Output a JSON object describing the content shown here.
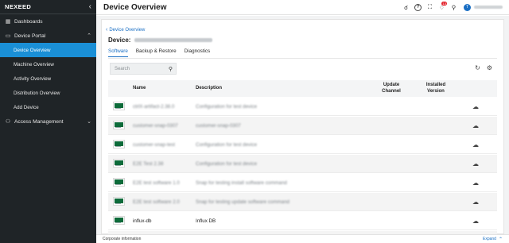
{
  "app": {
    "brand": "NEXEED"
  },
  "sidebar": {
    "items": [
      {
        "label": "Dashboards",
        "icon": "dashboard-icon"
      },
      {
        "label": "Device Portal",
        "icon": "monitor-icon",
        "expanded": true
      },
      {
        "label": "Device Overview",
        "active": true
      },
      {
        "label": "Machine Overview"
      },
      {
        "label": "Activity Overview"
      },
      {
        "label": "Distribution Overview"
      },
      {
        "label": "Add Device"
      },
      {
        "label": "Access Management",
        "icon": "users-icon",
        "expanded": false
      }
    ]
  },
  "header": {
    "title": "Device Overview",
    "notification_count": "13",
    "avatar_initial": "T"
  },
  "main": {
    "back_label": "Device Overview",
    "device_label": "Device:",
    "tabs": [
      {
        "label": "Software",
        "active": true
      },
      {
        "label": "Backup & Restore"
      },
      {
        "label": "Diagnostics"
      }
    ],
    "search_placeholder": "Search",
    "table": {
      "headers": {
        "name": "Name",
        "description": "Description",
        "update_channel": "Update Channel",
        "installed_version": "Installed Version"
      },
      "rows": [
        {
          "name": "ctrlX-artifact-2.38.0",
          "description": "Configuration for test device",
          "redacted": true
        },
        {
          "name": "customer-snap-0307",
          "description": "customer-snap-0307",
          "redacted": true
        },
        {
          "name": "customer-snap-test",
          "description": "Configuration for test device",
          "redacted": true
        },
        {
          "name": "E2E Test 2.38",
          "description": "Configuration for test device",
          "redacted": true
        },
        {
          "name": "E2E test software 1.0",
          "description": "Snap for testing install software command",
          "redacted": true
        },
        {
          "name": "E2E test software 2.0",
          "description": "Snap for testing update software command",
          "redacted": true
        },
        {
          "name": "influx-db",
          "description": "Influx DB",
          "redacted": false
        },
        {
          "name": "",
          "description": "",
          "redacted": true
        }
      ]
    }
  },
  "footer": {
    "info_label": "Corporate information",
    "expand_label": "Expand"
  },
  "colors": {
    "sidebar_bg": "#1f2427",
    "active_item": "#1a8fd6",
    "link": "#1a6fc4",
    "badge": "#e2202a",
    "thumbnail": "#0d6b3a"
  }
}
